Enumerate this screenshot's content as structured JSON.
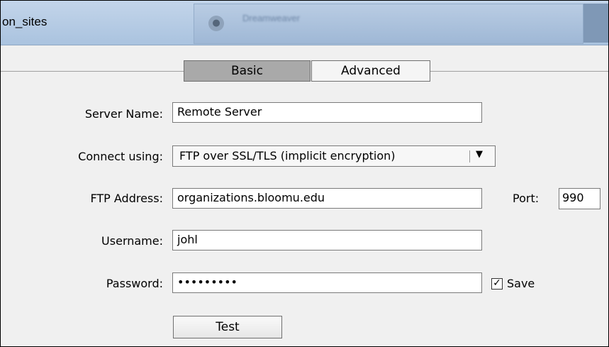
{
  "window": {
    "title": "on_sites",
    "taskbar_text": "Dreamweaver"
  },
  "tabs": [
    {
      "label": "Basic",
      "active": true
    },
    {
      "label": "Advanced",
      "active": false
    }
  ],
  "form": {
    "server_name": {
      "label": "Server Name:",
      "value": "Remote Server"
    },
    "connect_using": {
      "label": "Connect using:",
      "value": "FTP over SSL/TLS (implicit encryption)"
    },
    "ftp_address": {
      "label": "FTP Address:",
      "value": "organizations.bloomu.edu"
    },
    "port": {
      "label": "Port:",
      "value": "990"
    },
    "username": {
      "label": "Username:",
      "value": "johl"
    },
    "password": {
      "label": "Password:",
      "value": "•••••••••"
    },
    "save": {
      "label": "Save",
      "checked": true
    },
    "test_button": "Test"
  },
  "icons": {
    "dropdown_arrow": "chevron-down-icon",
    "checkmark": "check-icon"
  }
}
